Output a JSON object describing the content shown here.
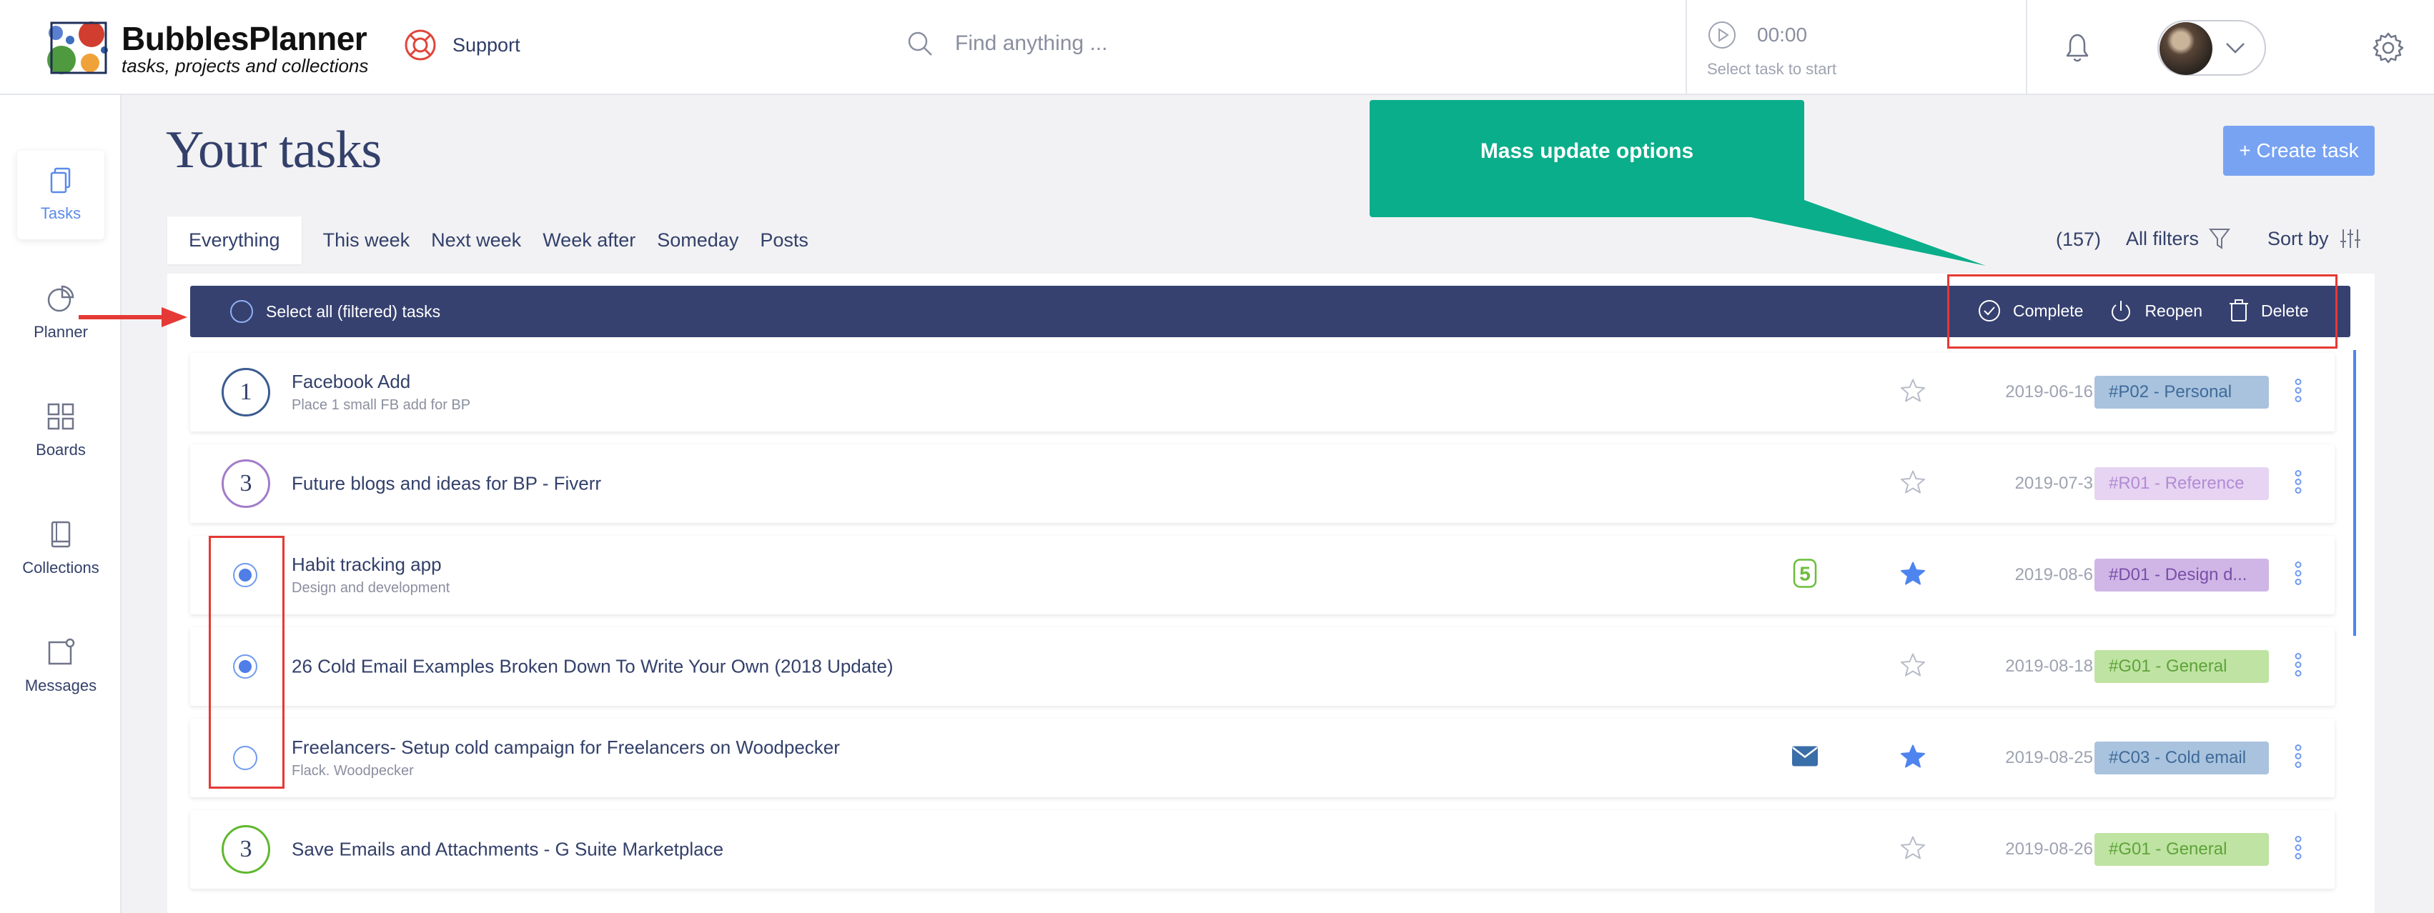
{
  "header": {
    "brand_name": "BubblesPlanner",
    "brand_tagline": "tasks, projects and collections",
    "support_label": "Support",
    "search_placeholder": "Find anything ...",
    "timer_value": "00:00",
    "timer_hint": "Select task to start"
  },
  "sidebar": {
    "items": [
      {
        "label": "Tasks",
        "icon": "tasks-icon",
        "active": true
      },
      {
        "label": "Planner",
        "icon": "pie-chart-icon"
      },
      {
        "label": "Boards",
        "icon": "grid-icon"
      },
      {
        "label": "Collections",
        "icon": "book-icon"
      },
      {
        "label": "Messages",
        "icon": "message-icon"
      }
    ]
  },
  "main": {
    "title": "Your tasks",
    "create_label": "+ Create task",
    "tabs": [
      "Everything",
      "This week",
      "Next week",
      "Week after",
      "Someday",
      "Posts"
    ],
    "count": "(157)",
    "filters_label": "All filters",
    "sort_label": "Sort by"
  },
  "mass_bar": {
    "select_all": "Select all (filtered) tasks",
    "complete": "Complete",
    "reopen": "Reopen",
    "delete": "Delete"
  },
  "annotation": {
    "callout": "Mass update options"
  },
  "tasks": [
    {
      "lead": "1",
      "lead_color": "#3a5c8f",
      "title": "Facebook Add",
      "subtitle": "Place 1 small FB add for BP",
      "starred": false,
      "date": "2019-06-16",
      "tag": "#P02 - Personal",
      "tag_bg": "#a9c3de",
      "tag_fg": "#3f6a99"
    },
    {
      "lead": "3",
      "lead_color": "#a27cc9",
      "title": "Future blogs and ideas for BP - Fiverr",
      "subtitle": "",
      "starred": false,
      "date": "2019-07-3",
      "tag": "#R01 - Reference",
      "tag_bg": "#e6d4f2",
      "tag_fg": "#b38bd4"
    },
    {
      "lead": "radio-on",
      "title": "Habit tracking app",
      "subtitle": "Design and development",
      "extra": "5",
      "starred": true,
      "date": "2019-08-6",
      "tag": "#D01 - Design d...",
      "tag_bg": "#cfb6e6",
      "tag_fg": "#7a4fa8"
    },
    {
      "lead": "radio-on",
      "title": "26 Cold Email Examples Broken Down To Write Your Own (2018 Update)",
      "subtitle": "",
      "starred": false,
      "date": "2019-08-18",
      "tag": "#G01 - General",
      "tag_bg": "#bfe3a2",
      "tag_fg": "#5ea33a"
    },
    {
      "lead": "radio-off",
      "title": "Freelancers- Setup cold campaign for Freelancers on Woodpecker",
      "subtitle": "Flack. Woodpecker",
      "extra": "mail",
      "starred": true,
      "date": "2019-08-25",
      "tag": "#C03 - Cold email",
      "tag_bg": "#a9c3de",
      "tag_fg": "#3f6a99"
    },
    {
      "lead": "3",
      "lead_color": "#5fb82e",
      "title": "Save Emails and Attachments - G Suite Marketplace",
      "subtitle": "",
      "starred": false,
      "date": "2019-08-26",
      "tag": "#G01 - General",
      "tag_bg": "#bfe3a2",
      "tag_fg": "#5ea33a"
    }
  ]
}
